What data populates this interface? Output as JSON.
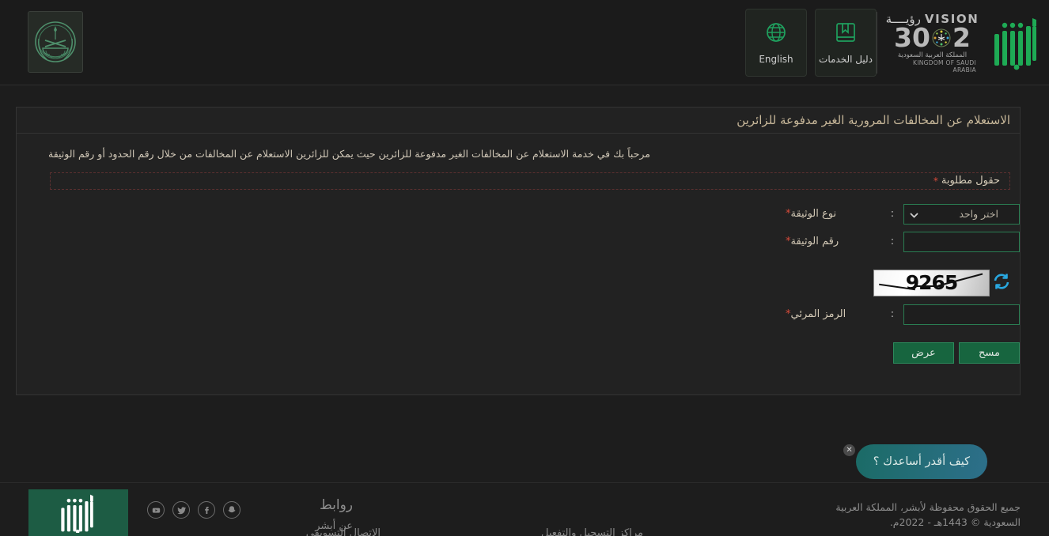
{
  "header": {
    "moi_emblem_icon": "saudi-ministry-of-interior-emblem",
    "buttons": [
      {
        "label": "English",
        "icon": "globe-icon"
      },
      {
        "label": "دليل الخدمات",
        "icon": "services-guide-book-icon"
      }
    ],
    "vision_logo": {
      "word_en": "VISION",
      "word_ar": "رؤيــــة",
      "digit_left": "2",
      "digit_right": "30",
      "sub_ar": "المملكة العربية السعودية",
      "sub_en": "KINGDOM OF SAUDI ARABIA"
    },
    "absher_logo_icon": "absher-logo"
  },
  "panel": {
    "title": "الاستعلام عن المخالفات المرورية الغير مدفوعة للزائرين",
    "description": "مرحباً بك في خدمة الاستعلام عن المخالفات الغير مدفوعة للزائرين حيث يمكن للزائرين الاستعلام عن المخالفات من خلال رقم الحدود أو رقم الوثيقة",
    "required_note": "حقول مطلوبة",
    "required_star": "*",
    "colon": ":",
    "fields": {
      "doc_type": {
        "label": "نوع الوثيقة",
        "star": "*",
        "selected": "اختر واحد"
      },
      "doc_number": {
        "label": "رقم الوثيقة",
        "star": "*",
        "value": ""
      },
      "captcha": {
        "label": "الرمز المرئي",
        "star": "*",
        "value": "",
        "image_text": "9265",
        "refresh_icon": "refresh-icon"
      }
    },
    "buttons": {
      "submit": "عرض",
      "clear": "مسح"
    }
  },
  "chat": {
    "bubble_text": "كيف أقدر أساعدك ؟",
    "close_icon": "close-icon",
    "fab_icon": "chat-assistant-icon"
  },
  "footer": {
    "logo_icon": "absher-logo-white",
    "social": [
      {
        "name": "snapchat-icon"
      },
      {
        "name": "facebook-icon"
      },
      {
        "name": "twitter-icon"
      },
      {
        "name": "youtube-icon"
      }
    ],
    "links_title": "روابط",
    "links": [
      {
        "label": "عن أبشر"
      },
      {
        "label": "مراكز التسجيل والتفعيل"
      },
      {
        "label": "الاتصال التسويقي"
      }
    ],
    "copyright": "جميع الحقوق محفوظة لأبشر، المملكة العربية السعودية © 1443هـ - 2022م."
  },
  "colors": {
    "page_bg": "#1d1d1d",
    "panel_bg": "#222222",
    "accent_green": "#2a7d52",
    "button_green": "#17653f",
    "required_red": "#d94b3a",
    "refresh_blue": "#29a8e0",
    "title_text": "#c8b89a"
  }
}
